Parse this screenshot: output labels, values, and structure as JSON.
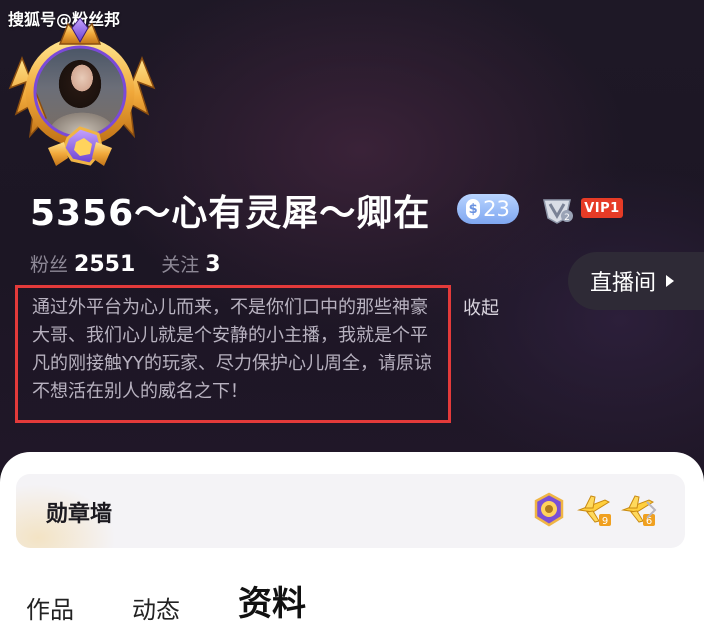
{
  "watermark": "搜狐号@粉丝邦",
  "profile": {
    "name": "5356～心有灵犀～卿在",
    "level": "23",
    "level_coin": "$",
    "v_level": "2",
    "vip": "VIP1"
  },
  "stats": {
    "fans_label": "粉丝",
    "fans_value": "2551",
    "follow_label": "关注",
    "follow_value": "3"
  },
  "live_button": "直播间",
  "bio": "通过外平台为心儿而来，不是你们口中的那些神豪大哥、我们心儿就是个安静的小主播，我就是个平凡的刚接触YY的玩家、尽力保护心儿周全，请原谅不想活在别人的威名之下！",
  "collapse_label": "收起",
  "medal_wall": {
    "title": "勋章墙",
    "badges": [
      "purple-medal-icon",
      "plane-medal-icon-9",
      "plane-medal-icon-6"
    ],
    "badge_numbers": [
      "9",
      "6"
    ]
  },
  "tabs": [
    {
      "label": "作品",
      "active": false
    },
    {
      "label": "动态",
      "active": false
    },
    {
      "label": "资料",
      "active": true
    }
  ],
  "colors": {
    "highlight_border": "#e33a3a",
    "vip": "#e63b26",
    "level_badge": "#7ea6f0"
  }
}
